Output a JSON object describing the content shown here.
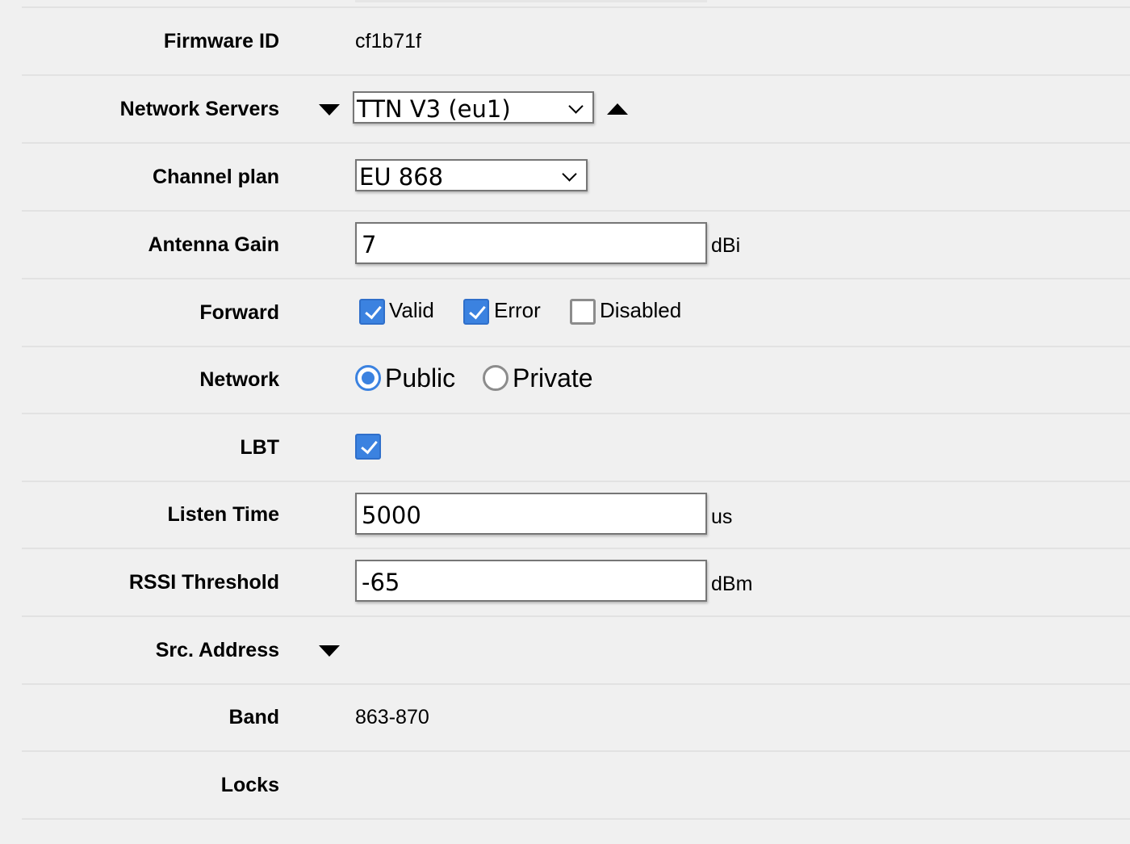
{
  "fields": {
    "firmware_id": {
      "label": "Firmware ID",
      "value": "cf1b71f"
    },
    "network_servers": {
      "label": "Network Servers",
      "selected": "TTN V3 (eu1)"
    },
    "channel_plan": {
      "label": "Channel plan",
      "selected": "EU 868"
    },
    "antenna_gain": {
      "label": "Antenna Gain",
      "value": "7",
      "unit": "dBi"
    },
    "forward": {
      "label": "Forward",
      "options": [
        {
          "label": "Valid",
          "checked": true
        },
        {
          "label": "Error",
          "checked": true
        },
        {
          "label": "Disabled",
          "checked": false
        }
      ]
    },
    "network": {
      "label": "Network",
      "options": [
        {
          "label": "Public",
          "selected": true
        },
        {
          "label": "Private",
          "selected": false
        }
      ]
    },
    "lbt": {
      "label": "LBT",
      "checked": true
    },
    "listen_time": {
      "label": "Listen Time",
      "value": "5000",
      "unit": "us"
    },
    "rssi_threshold": {
      "label": "RSSI Threshold",
      "value": "-65",
      "unit": "dBm"
    },
    "src_address": {
      "label": "Src. Address"
    },
    "band": {
      "label": "Band",
      "value": "863-870"
    },
    "locks": {
      "label": "Locks",
      "value": ""
    }
  },
  "icons": {
    "expand": "triangle-down-icon",
    "collapse": "triangle-up-icon",
    "dropdown": "chevron-down-icon",
    "check": "check-icon"
  },
  "colors": {
    "background": "#f0f0f0",
    "accent": "#3b82e0",
    "divider": "#e2e2e2"
  }
}
